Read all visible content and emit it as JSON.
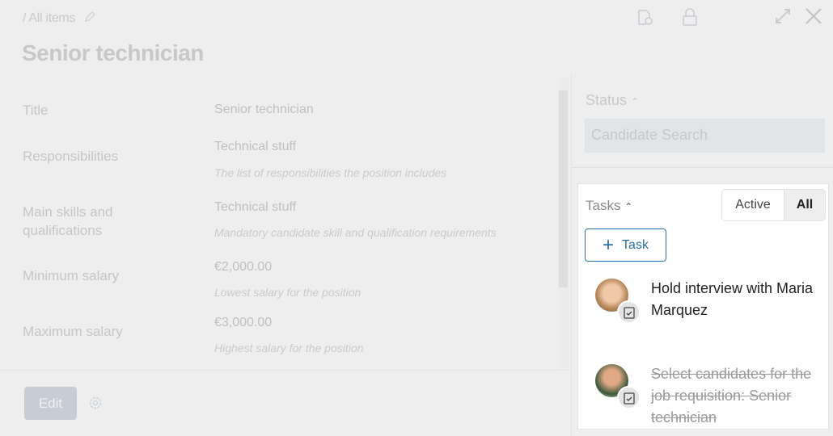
{
  "header": {
    "breadcrumb": "/ All items",
    "title": "Senior technician"
  },
  "fields": [
    {
      "label": "Title",
      "value": "Senior technician",
      "hint": ""
    },
    {
      "label": "Responsibilities",
      "value": "Technical stuff",
      "hint": "The list of responsibilities the position includes"
    },
    {
      "label": "Main skills and qualifications",
      "value": "Technical stuff",
      "hint": "Mandatory candidate skill and qualification requirements"
    },
    {
      "label": "Minimum salary",
      "value": "€2,000.00",
      "hint": "Lowest salary for the position"
    },
    {
      "label": "Maximum salary",
      "value": "€3,000.00",
      "hint": "Highest salary for the position"
    }
  ],
  "footer": {
    "edit_label": "Edit"
  },
  "status": {
    "label": "Status",
    "value": "Candidate Search"
  },
  "tasks": {
    "label": "Tasks",
    "filter_active": "Active",
    "filter_all": "All",
    "selected_filter": "All",
    "add_label": "Task",
    "items": [
      {
        "title": "Hold interview with Maria Marquez",
        "completed": false
      },
      {
        "title": "Select candidates for the job requisition: Senior technician",
        "completed": true
      }
    ]
  },
  "colors": {
    "accent": "#2a6fa8",
    "overlay": "#eeeeee"
  }
}
